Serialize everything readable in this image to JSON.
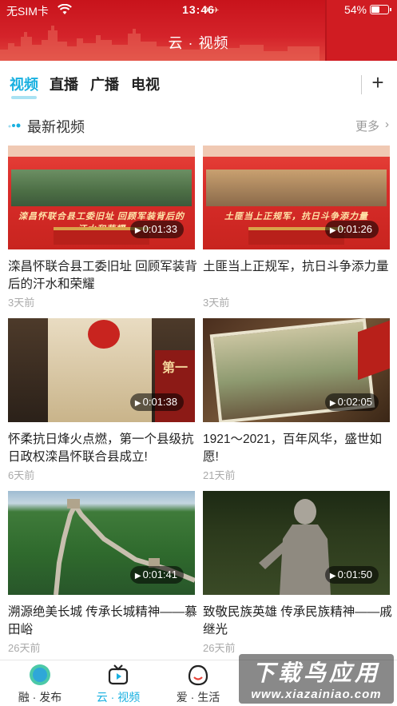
{
  "status_bar": {
    "carrier": "无SIM卡",
    "time": "13:46",
    "battery_pct": "54%",
    "battery_level": 0.54
  },
  "header": {
    "title": "云 · 视频"
  },
  "tabs": {
    "items": [
      {
        "label": "视频",
        "active": true
      },
      {
        "label": "直播",
        "active": false
      },
      {
        "label": "广播",
        "active": false
      },
      {
        "label": "电视",
        "active": false
      }
    ],
    "add_icon": "plus-icon"
  },
  "section": {
    "title": "最新视频",
    "more": "更多",
    "more_icon": "chevron-right-icon"
  },
  "videos": [
    {
      "title": "滦昌怀联合县工委旧址 回顾军装背后的汗水和荣耀",
      "duration": "0:01:33",
      "time": "3天前",
      "overlay": "滦昌怀联合县工委旧址 回顾军装背后的汗水和荣耀"
    },
    {
      "title": "土匪当上正规军，抗日斗争添力量",
      "duration": "0:01:26",
      "time": "3天前",
      "overlay": "土匪当上正规军，抗日斗争添力量"
    },
    {
      "title": "怀柔抗日烽火点燃，第一个县级抗日政权滦昌怀联合县成立!",
      "duration": "0:01:38",
      "time": "6天前",
      "overlay": "第一"
    },
    {
      "title": "1921～2021，百年风华，盛世如愿!",
      "duration": "0:02:05",
      "time": "21天前",
      "overlay": ""
    },
    {
      "title": "溯源绝美长城 传承长城精神——慕田峪",
      "duration": "0:01:41",
      "time": "26天前",
      "overlay": ""
    },
    {
      "title": "致敬民族英雄 传承民族精神——戚继光",
      "duration": "0:01:50",
      "time": "26天前",
      "overlay": ""
    }
  ],
  "bottom_nav": [
    {
      "label": "融 · 发布",
      "icon": "rong-logo-icon",
      "active": false
    },
    {
      "label": "云 · 视频",
      "icon": "tv-icon",
      "active": true
    },
    {
      "label": "爱 · 生活",
      "icon": "smile-icon",
      "active": false
    }
  ],
  "watermark": {
    "big": "下载鸟应用",
    "small": "www.xiazainiao.com"
  },
  "colors": {
    "accent": "#18b0e0",
    "header_red": "#d4232a"
  }
}
